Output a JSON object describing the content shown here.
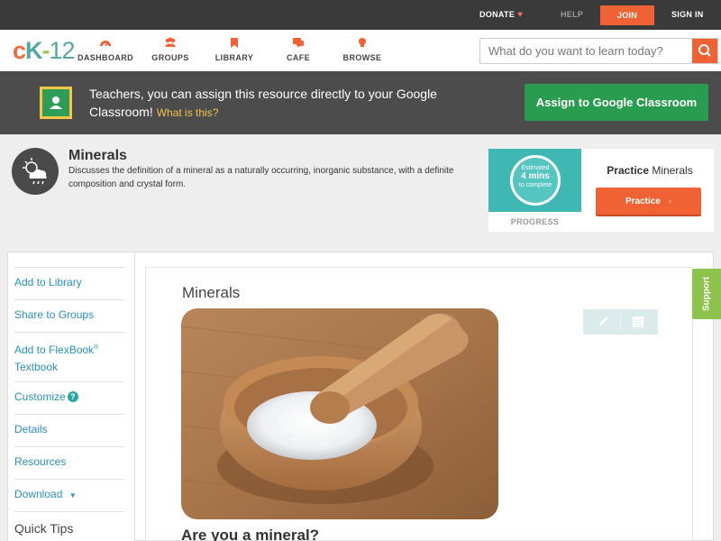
{
  "topbar": {
    "donate": "DONATE",
    "help": "HELP",
    "join": "JOIN",
    "signin": "SIGN IN"
  },
  "logo": {
    "c": "c",
    "k": "K",
    "dash": "-",
    "num": "12"
  },
  "nav": {
    "dashboard": "DASHBOARD",
    "groups": "GROUPS",
    "library": "LIBRARY",
    "cafe": "CAFE",
    "browse": "BROWSE"
  },
  "search": {
    "placeholder": "What do you want to learn today?"
  },
  "banner": {
    "text": "Teachers, you can assign this resource directly to your Google Classroom!",
    "what_link": "What is this?",
    "button": "Assign to Google Classroom"
  },
  "concept": {
    "title": "Minerals",
    "description": "Discusses the definition of a mineral as a naturally occurring, inorganic substance, with a definite composition and crystal form."
  },
  "practice": {
    "estimated": "Estimated",
    "mins": "4 mins",
    "to_complete": "to complete",
    "progress_label": "PROGRESS",
    "title_bold": "Practice",
    "title_rest": "Minerals",
    "button": "Practice"
  },
  "sidebar": {
    "add_library": "Add to Library",
    "share_groups": "Share to Groups",
    "add_flexbook": "Add to FlexBook",
    "reg": "®",
    "textbook": "Textbook",
    "customize": "Customize",
    "help_mark": "?",
    "details": "Details",
    "resources": "Resources",
    "download": "Download",
    "download_caret": "▼",
    "quick_tips": "Quick Tips"
  },
  "content": {
    "title": "Minerals",
    "subheading": "Are you a mineral?"
  },
  "support": "Support",
  "colors": {
    "accent": "#f06133",
    "link": "#2a8fbd",
    "classroom_green": "#2a9c4f",
    "support_green": "#8dc34a"
  }
}
